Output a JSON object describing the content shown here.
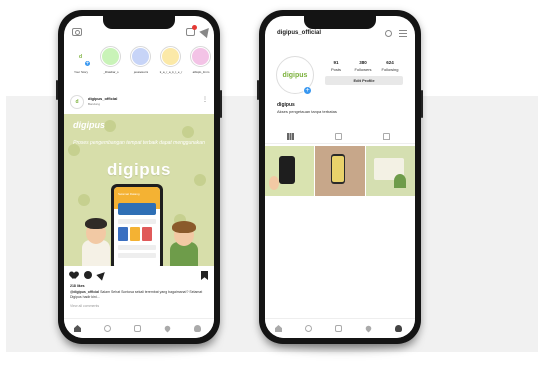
{
  "feed": {
    "stories": [
      {
        "label": "Your Story",
        "color": "#ffffff"
      },
      {
        "label": "_lihatdiar_s",
        "color": "#c9f3b8"
      },
      {
        "label": "jessiekurni",
        "color": "#c7d4f7"
      },
      {
        "label": "k_a_r_a_k_t_e_r",
        "color": "#fbe9a8"
      },
      {
        "label": "albiqlo_ilmm",
        "color": "#f3c3e6"
      }
    ],
    "post": {
      "username": "digipus_official",
      "subtitle": "Bandung",
      "more": "⋮",
      "image_logo": "digipus",
      "image_headline": "Proses pengembangan tempat terbaik dapat menggunakan",
      "image_brand": "digipus",
      "mock_app_label": "Selamat Datang",
      "likes": "218 likes",
      "caption_user": "@digipus_official",
      "caption_text": "Salam Sehat Sontosa sekali terembat yang bagaimana!? Selamat Digipus hadir kini...",
      "view_comments": "View all comments"
    }
  },
  "profile": {
    "username": "digipus_official",
    "avatar_logo": "digipus",
    "stats": [
      {
        "value": "91",
        "label": "Posts"
      },
      {
        "value": "380",
        "label": "Followers"
      },
      {
        "value": "624",
        "label": "Following"
      }
    ],
    "edit_button": "Edit Profile",
    "display_name": "digipus",
    "bio": "Akses pengetauan tanpa terbatas"
  },
  "colors": {
    "brand_green": "#7bb13b",
    "post_bg": "#d7deaa",
    "accent_blue": "#3897f0",
    "phone_frame": "#141414"
  },
  "icons": {
    "feed_top": [
      "camera-icon",
      "igtv-icon",
      "direct-message-icon"
    ],
    "post_actions": [
      "heart-icon",
      "comment-icon",
      "share-icon",
      "bookmark-icon"
    ],
    "tabbar": [
      "home-icon",
      "search-icon",
      "add-post-icon",
      "activity-heart-icon",
      "profile-icon"
    ],
    "profile_top": [
      "history-icon",
      "menu-icon"
    ],
    "profile_tabs": [
      "grid-icon",
      "igtv-tab-icon",
      "tagged-icon"
    ]
  }
}
